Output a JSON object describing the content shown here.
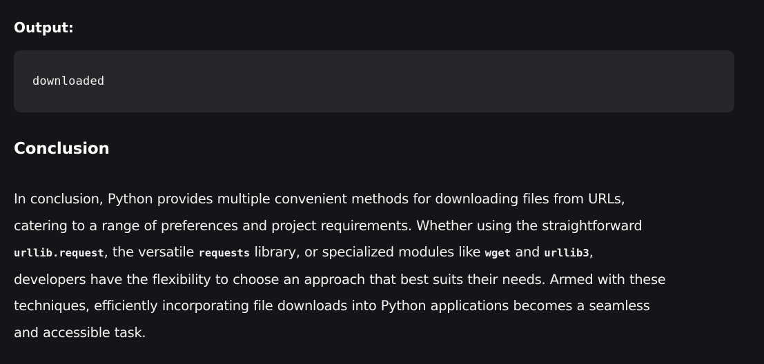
{
  "output_section": {
    "label": "Output:",
    "code": "downloaded"
  },
  "conclusion": {
    "heading": "Conclusion",
    "lines": [
      {
        "text": "In conclusion, Python provides multiple convenient methods for downloading files from URLs,"
      },
      {
        "text": "catering to a range of preferences and project requirements. Whether using the straightforward"
      },
      {
        "code1": "urllib.request",
        "text1": ", the versatile ",
        "code2": "requests",
        "text2": " library, or specialized modules like ",
        "code3": "wget",
        "text3": " and ",
        "code4": "urllib3",
        "text4": ","
      },
      {
        "text": "developers have the flexibility to choose an approach that best suits their needs. Armed with these"
      },
      {
        "text": "techniques, efficiently incorporating file downloads into Python applications becomes a seamless"
      },
      {
        "text": "and accessible task."
      }
    ]
  }
}
